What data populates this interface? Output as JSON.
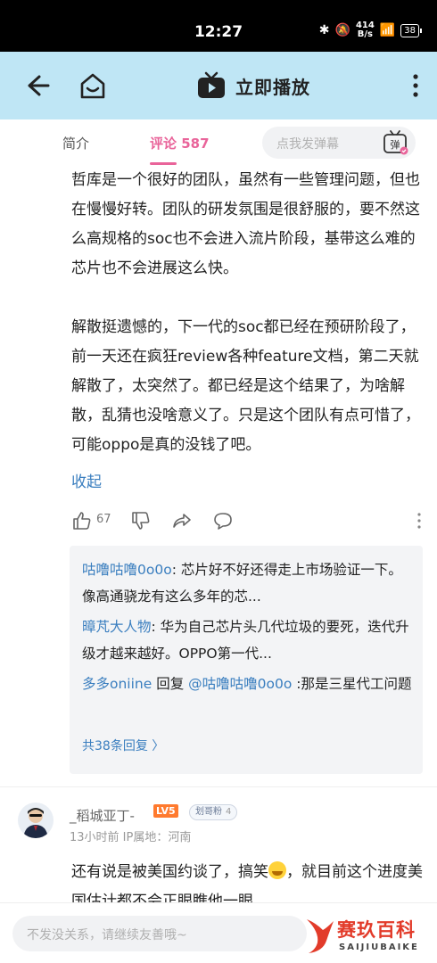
{
  "status": {
    "time": "12:27",
    "net_speed_top": "414",
    "net_speed_bottom": "B/s",
    "battery": "38"
  },
  "appbar": {
    "play_label": "立即播放"
  },
  "tabs": {
    "intro": "简介",
    "comments": "评论 587",
    "danmu_placeholder": "点我发弹幕",
    "danmu_button": "弹"
  },
  "comment1": {
    "para1": "哲库是一个很好的团队，虽然有一些管理问题，但也在慢慢好转。团队的研发氛围是很舒服的，要不然这么高规格的soc也不会进入流片阶段，基带这么难的芯片也不会进展这么快。",
    "para2": "解散挺遗憾的，下一代的soc都已经在预研阶段了，前一天还在疯狂review各种feature文档，第二天就解散了，太突然了。都已经是这个结果了，为啥解散，乱猜也没啥意义了。只是这个团队有点可惜了，可能oppo是真的没钱了吧。",
    "collapse": "收起",
    "likes": "67"
  },
  "replies": [
    {
      "name": "咕噜咕噜0o0o",
      "sep": ": ",
      "text": "芯片好不好还得走上市场验证一下。像高通骁龙有这么多年的芯..."
    },
    {
      "name": "暲芃大人物",
      "sep": ": ",
      "text": "华为自己芯片头几代垃圾的要死，迭代升级才越来越好。OPPO第一代..."
    },
    {
      "name": "多多oniine",
      "mid": " 回复 ",
      "target": "@咕噜咕噜0o0o",
      "text": " :那是三星代工问题"
    }
  ],
  "replies_total": "共38条回复 〉",
  "comment2": {
    "username": "_稻城亚丁-",
    "level": "LV5",
    "badge": "划哥粉",
    "badge_level": "4",
    "meta": "13小时前 IP属地：河南",
    "text_before": "还有说是被美国约谈了，搞笑",
    "text_after": "，就目前这个进度美国估计都不会正眼瞧他一眼"
  },
  "input": {
    "placeholder": "不发没关系，请继续友善哦~"
  },
  "watermark": {
    "cn": "赛玖百科",
    "en": "SAIJIUBAIKE"
  },
  "colors": {
    "accent_pink": "#e9649a",
    "link_blue": "#3a7ebf",
    "appbar_bg": "#bfe6f5"
  }
}
